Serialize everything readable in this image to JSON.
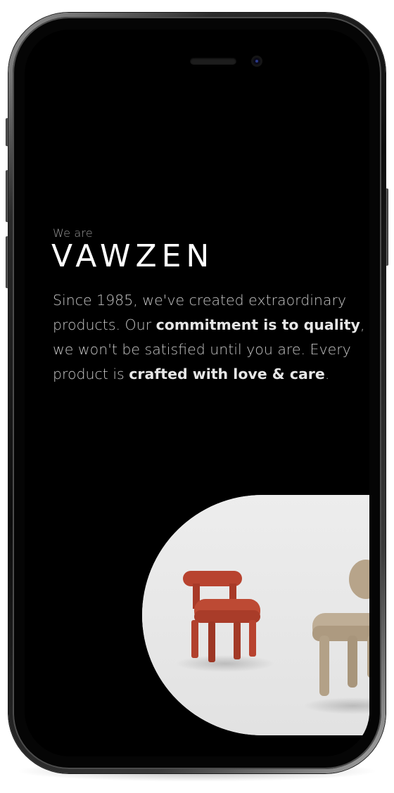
{
  "hero": {
    "eyebrow": "We are",
    "brand": "VAWZEN",
    "intro": {
      "p1": "Since 1985, we've created extraordinary products. Our ",
      "b1": "commitment is to quality",
      "p2": ", we won't be satisfied until you are. Every product is ",
      "b2": "crafted with love & care",
      "p3": "."
    }
  },
  "product_image": {
    "subject": "chairs",
    "colors": {
      "red_chair": "#b8432f",
      "tan_chair": "#b9a892",
      "backdrop": "#ececec"
    }
  },
  "theme": {
    "background": "#000000",
    "text_primary": "#ffffff",
    "text_secondary": "#c6c6c6"
  }
}
